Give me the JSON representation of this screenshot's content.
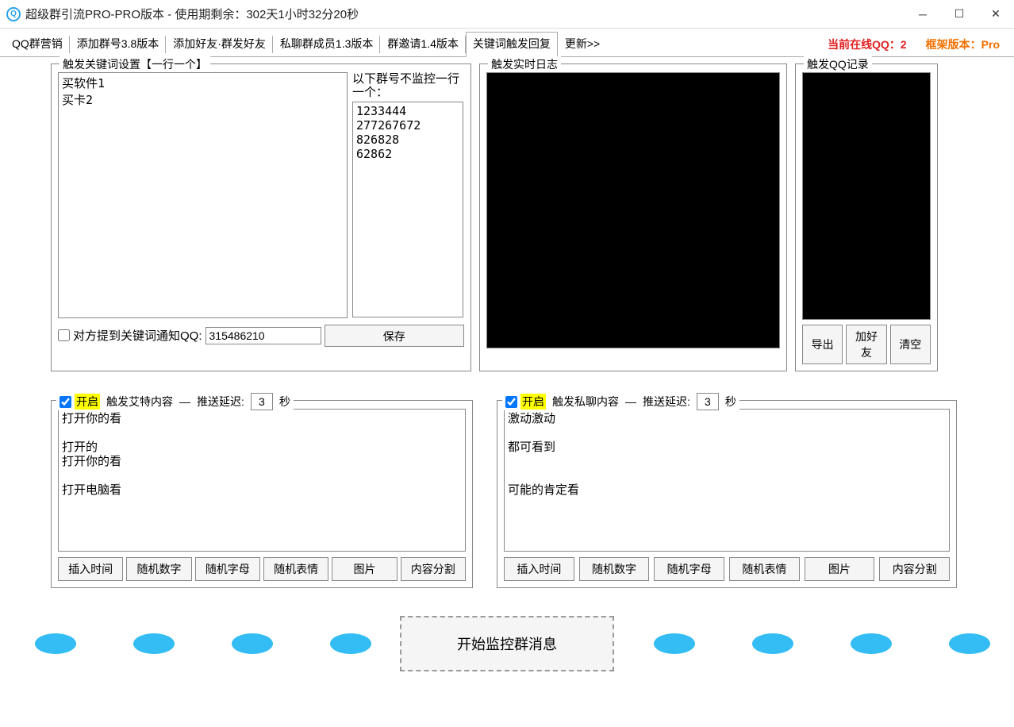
{
  "titlebar": {
    "title": "超级群引流PRO-PRO版本 - 使用期剩余：302天1小时32分20秒"
  },
  "tabs": {
    "items": [
      "QQ群营销",
      "添加群号3.8版本",
      "添加好友·群发好友",
      "私聊群成员1.3版本",
      "群邀请1.4版本",
      "关键词触发回复",
      "更新>>"
    ],
    "activeIndex": 5
  },
  "status": {
    "online_qq": "当前在线QQ：2",
    "framework_version": "框架版本：Pro"
  },
  "keywords": {
    "legend": "触发关键词设置【一行一个】",
    "value": "买软件1\n买卡2",
    "exclude_label": "以下群号不监控一行一个：",
    "exclude_value": "1233444\n277267672\n826828\n62862",
    "notify_label": "对方提到关键词通知QQ:",
    "notify_qq": "315486210",
    "save_btn": "保存"
  },
  "log": {
    "legend": "触发实时日志"
  },
  "qq_record": {
    "legend": "触发QQ记录",
    "export_btn": "导出",
    "add_friend_btn": "加好友",
    "clear_btn": "清空"
  },
  "at_content": {
    "enable_label": "开启",
    "legend_mid": "触发艾特内容",
    "delay_label": "推送延迟:",
    "delay_value": "3",
    "delay_unit": "秒",
    "value": "打开你的看\n\n打开的\n打开你的看\n\n打开电脑看",
    "buttons": [
      "插入时间",
      "随机数字",
      "随机字母",
      "随机表情",
      "图片",
      "内容分割"
    ]
  },
  "pm_content": {
    "enable_label": "开启",
    "legend_mid": "触发私聊内容",
    "delay_label": "推送延迟:",
    "delay_value": "3",
    "delay_unit": "秒",
    "value": "激动激动\n\n都可看到\n\n\n可能的肯定看",
    "buttons": [
      "插入时间",
      "随机数字",
      "随机字母",
      "随机表情",
      "图片",
      "内容分割"
    ]
  },
  "main_button": "开始监控群消息"
}
